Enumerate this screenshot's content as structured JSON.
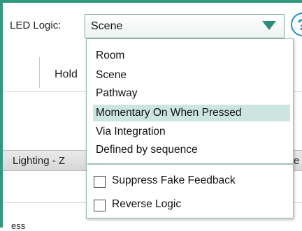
{
  "led_logic": {
    "label": "LED Logic:",
    "selected_value": "Scene",
    "options": [
      "Room",
      "Scene",
      "Pathway",
      "Momentary On When Pressed",
      "Via Integration",
      "Defined by sequence"
    ],
    "highlighted_option": "Momentary On When Pressed"
  },
  "help": {
    "glyph": "?"
  },
  "background": {
    "hold_text": "Hold",
    "lighting_text": "Lighting - Z",
    "right_cut_text": "e",
    "bottom_text": "ess"
  },
  "checkboxes": [
    {
      "label": "Suppress Fake Feedback",
      "checked": false
    },
    {
      "label": "Reverse Logic",
      "checked": false
    }
  ],
  "colors": {
    "accent": "#2f9a7f",
    "arrow": "#2a8f78",
    "highlight": "#cde5e0",
    "help_blue": "#1f8fc4"
  }
}
